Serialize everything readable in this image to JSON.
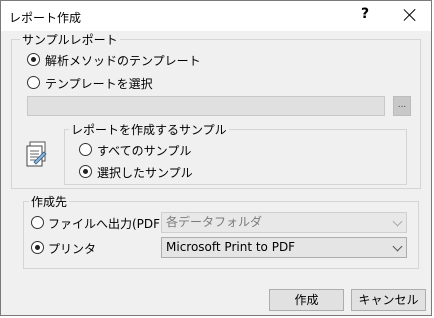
{
  "window": {
    "title": "レポート作成",
    "help_label": "?"
  },
  "sample_report": {
    "legend": "サンプルレポート",
    "options": [
      {
        "label": "解析メソッドのテンプレート",
        "checked": true
      },
      {
        "label": "テンプレートを選択",
        "checked": false
      }
    ],
    "path_value": "",
    "browse_label": "...",
    "target": {
      "legend": "レポートを作成するサンプル",
      "options": [
        {
          "label": "すべてのサンプル",
          "checked": false
        },
        {
          "label": "選択したサンプル",
          "checked": true
        }
      ]
    }
  },
  "destination": {
    "legend": "作成先",
    "file_option": {
      "label": "ファイルへ出力(PDF)",
      "checked": false,
      "select_value": "各データフォルダ"
    },
    "printer_option": {
      "label": "プリンタ",
      "checked": true,
      "select_value": "Microsoft Print to PDF"
    }
  },
  "buttons": {
    "create": "作成",
    "cancel": "キャンセル"
  },
  "icons": {
    "report": "report-document-icon",
    "close": "close-icon",
    "dropdown": "chevron-down-icon"
  }
}
